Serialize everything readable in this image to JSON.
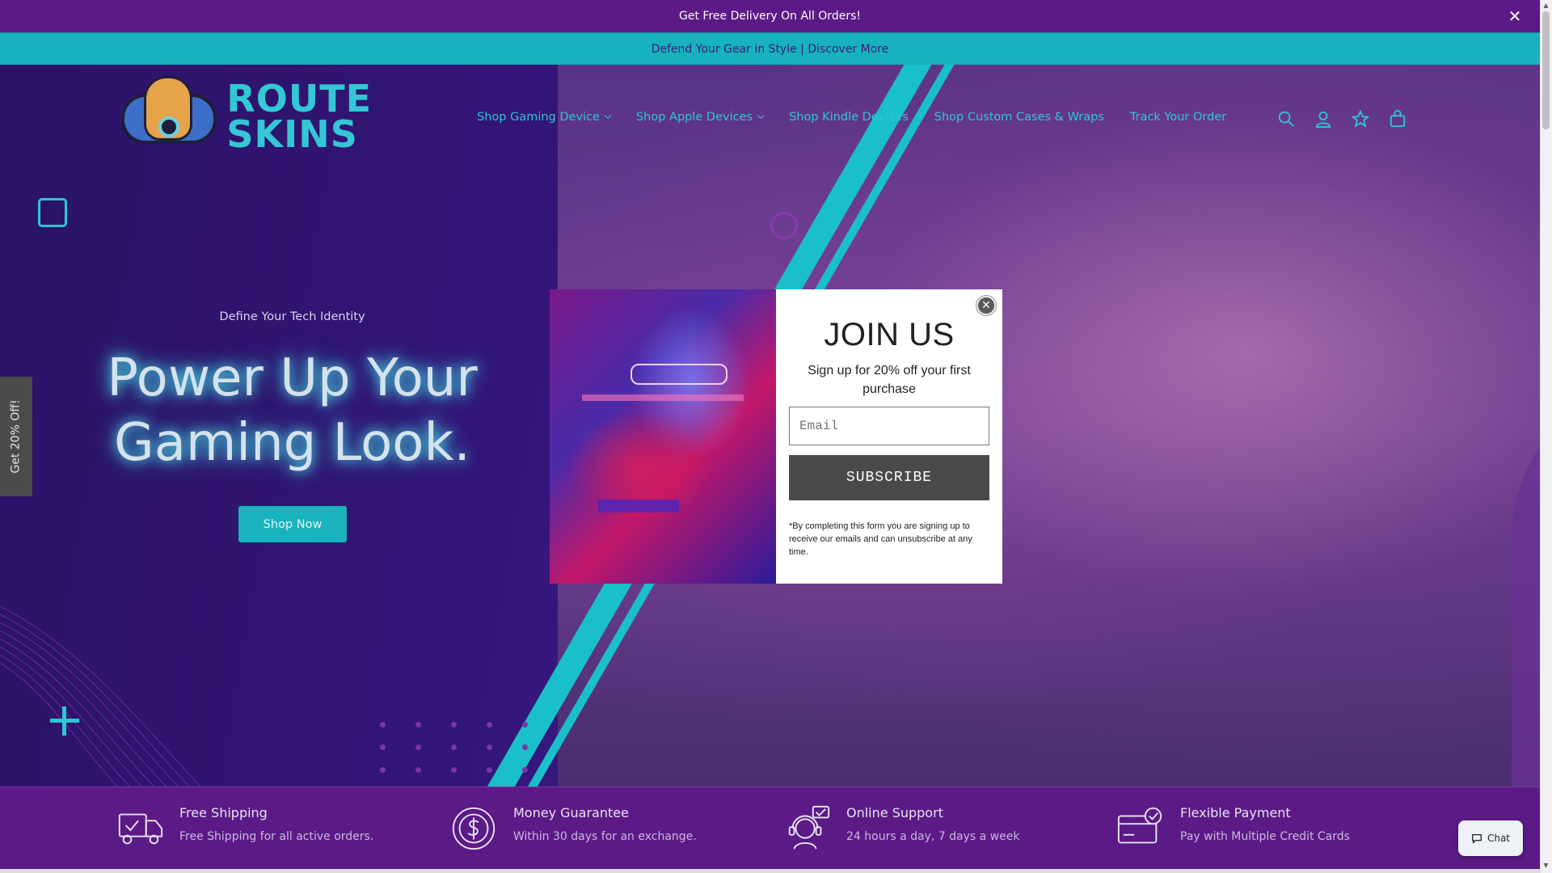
{
  "announcement": {
    "text": "Get Free Delivery On All Orders!",
    "close_icon": "close-icon"
  },
  "promo_bar": {
    "text": "Defend Your Gear in Style | Discover More"
  },
  "logo": {
    "line1": "ROUTE",
    "line2": "SKINS"
  },
  "nav": {
    "items": [
      {
        "label": "Shop Gaming Device",
        "has_dropdown": true
      },
      {
        "label": "Shop Apple Devices",
        "has_dropdown": true
      },
      {
        "label": "Shop Kindle Devices",
        "has_dropdown": false
      },
      {
        "label": "Shop Custom Cases & Wraps",
        "has_dropdown": false
      },
      {
        "label": "Track Your Order",
        "has_dropdown": false
      }
    ],
    "icons": [
      "search-icon",
      "account-icon",
      "wishlist-icon",
      "cart-icon"
    ]
  },
  "hero": {
    "tagline": "Define Your Tech Identity",
    "title_line1": "Power Up Your",
    "title_line2": "Gaming Look.",
    "cta": "Shop Now"
  },
  "side_tab": {
    "label": "Get 20% Off!"
  },
  "popup": {
    "title": "JOIN US",
    "subtitle": "Sign up for 20% off your first purchase",
    "email_placeholder": "Email",
    "button": "SUBSCRIBE",
    "disclaimer": "*By completing this form you are signing up to receive our emails and can unsubscribe at any time."
  },
  "features": [
    {
      "icon": "truck-icon",
      "title": "Free Shipping",
      "desc": "Free Shipping for all active orders."
    },
    {
      "icon": "money-icon",
      "title": "Money Guarantee",
      "desc": "Within 30 days for an exchange."
    },
    {
      "icon": "support-icon",
      "title": "Online Support",
      "desc": "24 hours a day, 7 days a week"
    },
    {
      "icon": "card-icon",
      "title": "Flexible Payment",
      "desc": "Pay with Multiple Credit Cards"
    }
  ],
  "chat": {
    "label": "Chat"
  },
  "colors": {
    "accent": "#19b3bd",
    "brand_purple": "#5b1a86",
    "hero_bg": "#2a1363"
  }
}
